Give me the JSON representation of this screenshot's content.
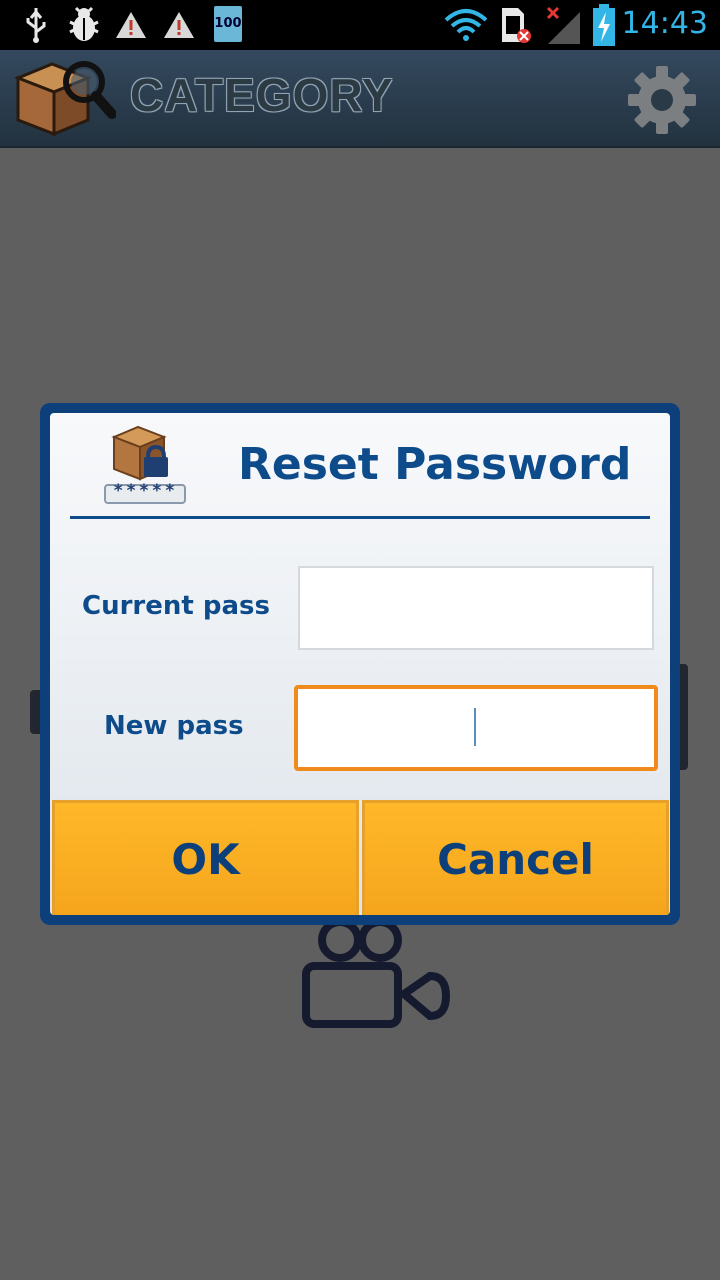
{
  "status_bar": {
    "time": "14:43",
    "battery_badge": "100",
    "icons": [
      "usb-icon",
      "bug-icon",
      "warning-icon",
      "warning-icon",
      "battery-100-icon",
      "wifi-icon",
      "sim-error-icon",
      "signal-icon",
      "charging-icon"
    ]
  },
  "app_bar": {
    "title": "CATEGORY",
    "logo_icon": "box-search-icon",
    "settings_icon": "gear-icon"
  },
  "dialog": {
    "title": "Reset Password",
    "icon": "box-lock-icon",
    "password_mask": "*****",
    "fields": [
      {
        "label": "Current pass",
        "value": "",
        "placeholder": ""
      },
      {
        "label": "New pass",
        "value": "",
        "placeholder": ""
      }
    ],
    "buttons": {
      "ok": "OK",
      "cancel": "Cancel"
    }
  },
  "colors": {
    "dialog_border": "#0d3f7a",
    "title_text": "#0d4b8a",
    "button": "#ffb829",
    "focus": "#f08a1c",
    "status_accent": "#33b5e5"
  }
}
